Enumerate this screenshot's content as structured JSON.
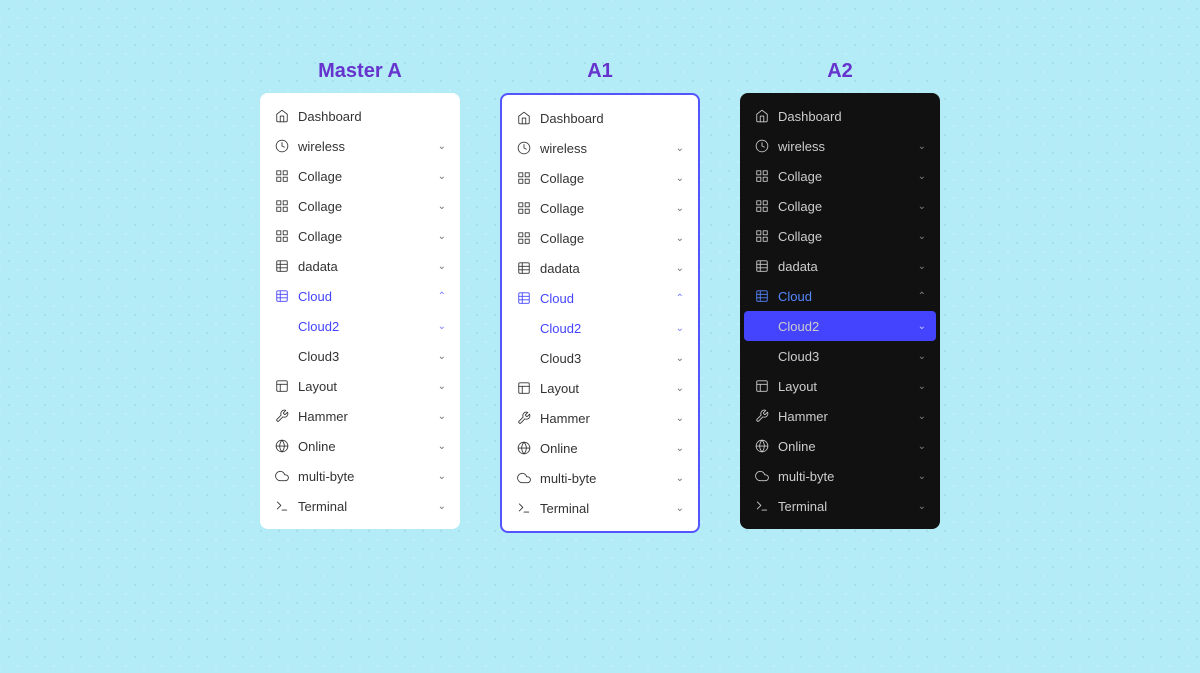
{
  "panels": [
    {
      "id": "master-a",
      "title": "Master A",
      "theme": "light",
      "bordered": false
    },
    {
      "id": "a1",
      "title": "A1",
      "theme": "light",
      "bordered": true
    },
    {
      "id": "a2",
      "title": "A2",
      "theme": "dark",
      "bordered": false
    }
  ],
  "menu_items": [
    {
      "id": "dashboard",
      "label": "Dashboard",
      "icon": "home",
      "chevron": false,
      "state": "normal"
    },
    {
      "id": "wireless",
      "label": "wireless",
      "icon": "clock",
      "chevron": true,
      "state": "normal"
    },
    {
      "id": "collage1",
      "label": "Collage",
      "icon": "grid",
      "chevron": true,
      "state": "normal"
    },
    {
      "id": "collage2",
      "label": "Collage",
      "icon": "grid",
      "chevron": true,
      "state": "normal"
    },
    {
      "id": "collage3",
      "label": "Collage",
      "icon": "grid",
      "chevron": true,
      "state": "normal"
    },
    {
      "id": "dadata",
      "label": "dadata",
      "icon": "table",
      "chevron": true,
      "state": "normal"
    },
    {
      "id": "cloud",
      "label": "Cloud",
      "icon": "table2",
      "chevron": true,
      "state": "active-parent"
    },
    {
      "id": "cloud2",
      "label": "Cloud2",
      "icon": null,
      "chevron": true,
      "state": "active-child"
    },
    {
      "id": "cloud3",
      "label": "Cloud3",
      "icon": null,
      "chevron": true,
      "state": "normal"
    },
    {
      "id": "layout",
      "label": "Layout",
      "icon": "layout",
      "chevron": true,
      "state": "normal"
    },
    {
      "id": "hammer",
      "label": "Hammer",
      "icon": "tool",
      "chevron": true,
      "state": "normal"
    },
    {
      "id": "online",
      "label": "Online",
      "icon": "globe",
      "chevron": true,
      "state": "normal"
    },
    {
      "id": "multibyte",
      "label": "multi-byte",
      "icon": "cloud",
      "chevron": true,
      "state": "normal"
    },
    {
      "id": "terminal",
      "label": "Terminal",
      "icon": "terminal",
      "chevron": true,
      "state": "normal"
    }
  ],
  "titles": {
    "master_a": "Master A",
    "a1": "A1",
    "a2": "A2"
  }
}
